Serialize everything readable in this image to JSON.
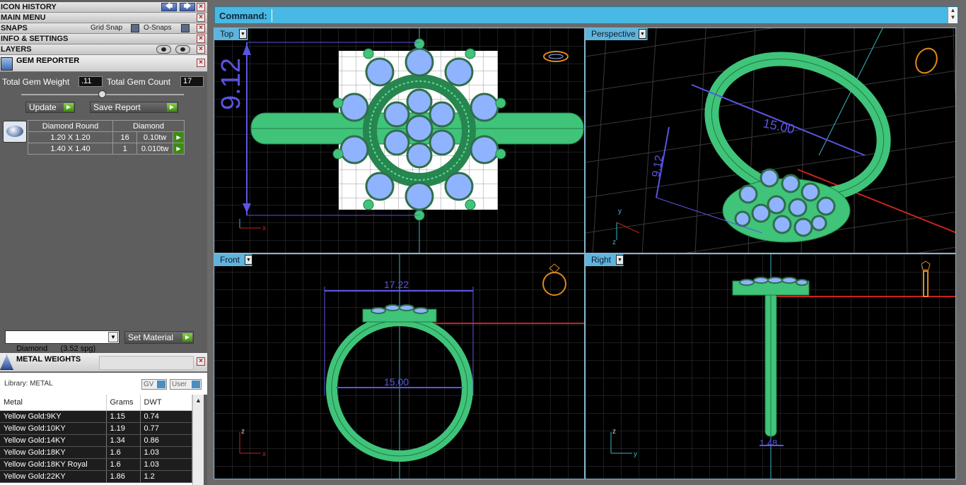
{
  "panels": {
    "icon_history": "ICON HISTORY",
    "main_menu": "MAIN MENU",
    "snaps": "SNAPS",
    "grid_snap": "Grid Snap",
    "o_snaps": "O-Snaps",
    "info_settings": "INFO & SETTINGS",
    "layers": "LAYERS",
    "close": "×",
    "back_arrow": "🡄",
    "forward_arrow": "🡆"
  },
  "gem_reporter": {
    "title": "GEM REPORTER",
    "total_weight_label": "Total Gem Weight",
    "total_weight_value": ".11",
    "total_count_label": "Total Gem Count",
    "total_count_value": "17",
    "update_label": "Update",
    "save_report_label": "Save Report",
    "go_glyph": "▶",
    "header": [
      "Diamond Round",
      "Diamond"
    ],
    "rows": [
      {
        "size": "1.20 X 1.20",
        "count": "16",
        "weight": "0.10tw"
      },
      {
        "size": "1.40 X 1.40",
        "count": "1",
        "weight": "0.010tw"
      }
    ],
    "material_value": "Diamond      (3.52 spg)",
    "set_material_label": "Set Material",
    "dropdown_glyph": "▼"
  },
  "metal_weights": {
    "title": "METAL WEIGHTS",
    "library_label": "Library: METAL",
    "gv_label": "GV",
    "user_label": "User",
    "columns": [
      "Metal",
      "Grams",
      "DWT"
    ],
    "rows": [
      {
        "metal": "Yellow Gold:9KY",
        "grams": "1.15",
        "dwt": "0.74"
      },
      {
        "metal": "Yellow Gold:10KY",
        "grams": "1.19",
        "dwt": "0.77"
      },
      {
        "metal": "Yellow Gold:14KY",
        "grams": "1.34",
        "dwt": "0.86"
      },
      {
        "metal": "Yellow Gold:18KY",
        "grams": "1.6",
        "dwt": "1.03"
      },
      {
        "metal": "Yellow Gold:18KY Royal",
        "grams": "1.6",
        "dwt": "1.03"
      },
      {
        "metal": "Yellow Gold:22KY",
        "grams": "1.86",
        "dwt": "1.2"
      }
    ],
    "scroll_up": "▲"
  },
  "command": {
    "label": "Command:",
    "value": "",
    "scroll_up": "▲",
    "scroll_down": "▼"
  },
  "viewports": {
    "top": {
      "label": "Top",
      "dim_vertical": "9.12"
    },
    "perspective": {
      "label": "Perspective",
      "dim_width": "15.00",
      "dim_height": "9.12"
    },
    "front": {
      "label": "Front",
      "dim_outer": "17.22",
      "dim_inner": "15.00"
    },
    "right": {
      "label": "Right",
      "dim_shank": "1.48"
    },
    "dropdown_glyph": "▼",
    "axis_x": "x",
    "axis_y": "y",
    "axis_z": "z"
  },
  "colors": {
    "viewport_label_bg": "#5eb4dd",
    "ring_green": "#3ecf7a",
    "gem_blue": "#8fb3ff",
    "dimension_blue": "#5a55e0",
    "axis_red": "#c8241e",
    "axis_cyan": "#38b8c8"
  }
}
